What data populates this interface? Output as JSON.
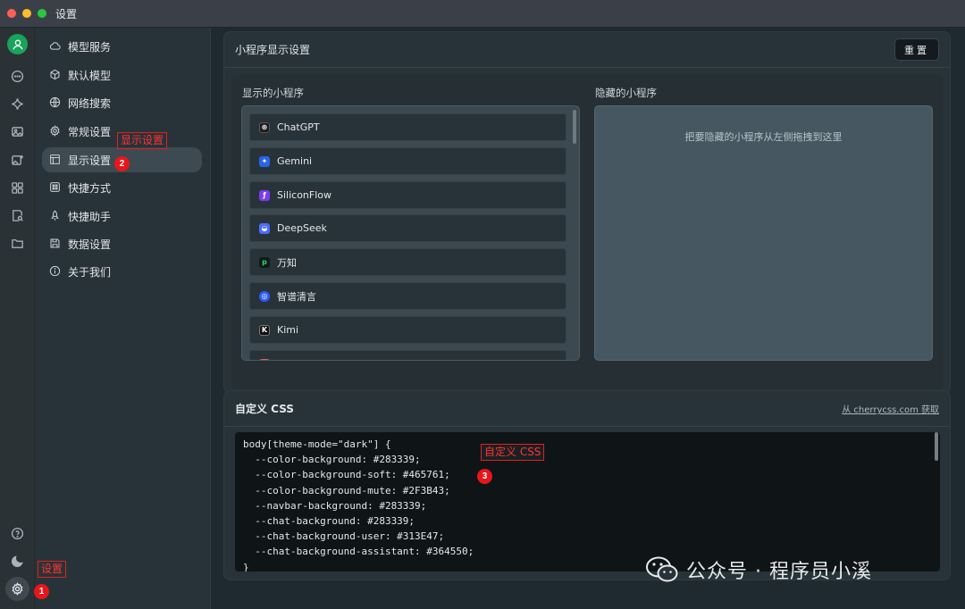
{
  "window": {
    "title": "设置"
  },
  "rail": {
    "icons": [
      "avatar-icon",
      "chat-icon",
      "sparkle-icon",
      "image-icon",
      "image-plus-icon",
      "apps-grid-icon",
      "doc-search-icon",
      "folder-icon",
      "help-icon",
      "moon-icon",
      "gear-icon"
    ]
  },
  "nav": {
    "items": [
      {
        "label": "模型服务",
        "icon": "cloud-icon"
      },
      {
        "label": "默认模型",
        "icon": "cube-icon"
      },
      {
        "label": "网络搜索",
        "icon": "globe-icon"
      },
      {
        "label": "常规设置",
        "icon": "gear-icon"
      },
      {
        "label": "显示设置",
        "icon": "layout-icon",
        "active": true
      },
      {
        "label": "快捷方式",
        "icon": "command-icon"
      },
      {
        "label": "快捷助手",
        "icon": "rocket-icon"
      },
      {
        "label": "数据设置",
        "icon": "save-icon"
      },
      {
        "label": "关于我们",
        "icon": "info-icon"
      }
    ]
  },
  "miniapp": {
    "title": "小程序显示设置",
    "reset_label": "重置",
    "visible_title": "显示的小程序",
    "hidden_title": "隐藏的小程序",
    "hidden_placeholder": "把要隐藏的小程序从左侧拖拽到这里",
    "visible_apps": [
      {
        "name": "ChatGPT",
        "color": "#1e1e1e"
      },
      {
        "name": "Gemini",
        "color": "#2a63e8"
      },
      {
        "name": "SiliconFlow",
        "color": "#7a3cf0"
      },
      {
        "name": "DeepSeek",
        "color": "#4d6bfe"
      },
      {
        "name": "万知",
        "color": "#0f1b14"
      },
      {
        "name": "智谱清言",
        "color": "#2e5bff"
      },
      {
        "name": "Kimi",
        "color": "#111111"
      }
    ]
  },
  "css": {
    "title": "自定义 CSS",
    "link_label": "从 cherrycss.com 获取",
    "code_lines": [
      "body[theme-mode=\"dark\"] {",
      "  --color-background: #283339;",
      "  --color-background-soft: #465761;",
      "  --color-background-mute: #2F3B43;",
      "  --navbar-background: #283339;",
      "  --chat-background: #283339;",
      "  --chat-background-user: #313E47;",
      "  --chat-background-assistant: #364550;",
      "}"
    ]
  },
  "annotations": {
    "a1_label": "设置",
    "a1_num": "1",
    "a2_label": "显示设置",
    "a2_num": "2",
    "a3_label": "自定义 CSS",
    "a3_num": "3"
  },
  "watermark": {
    "text": "公众号 · 程序员小溪"
  }
}
